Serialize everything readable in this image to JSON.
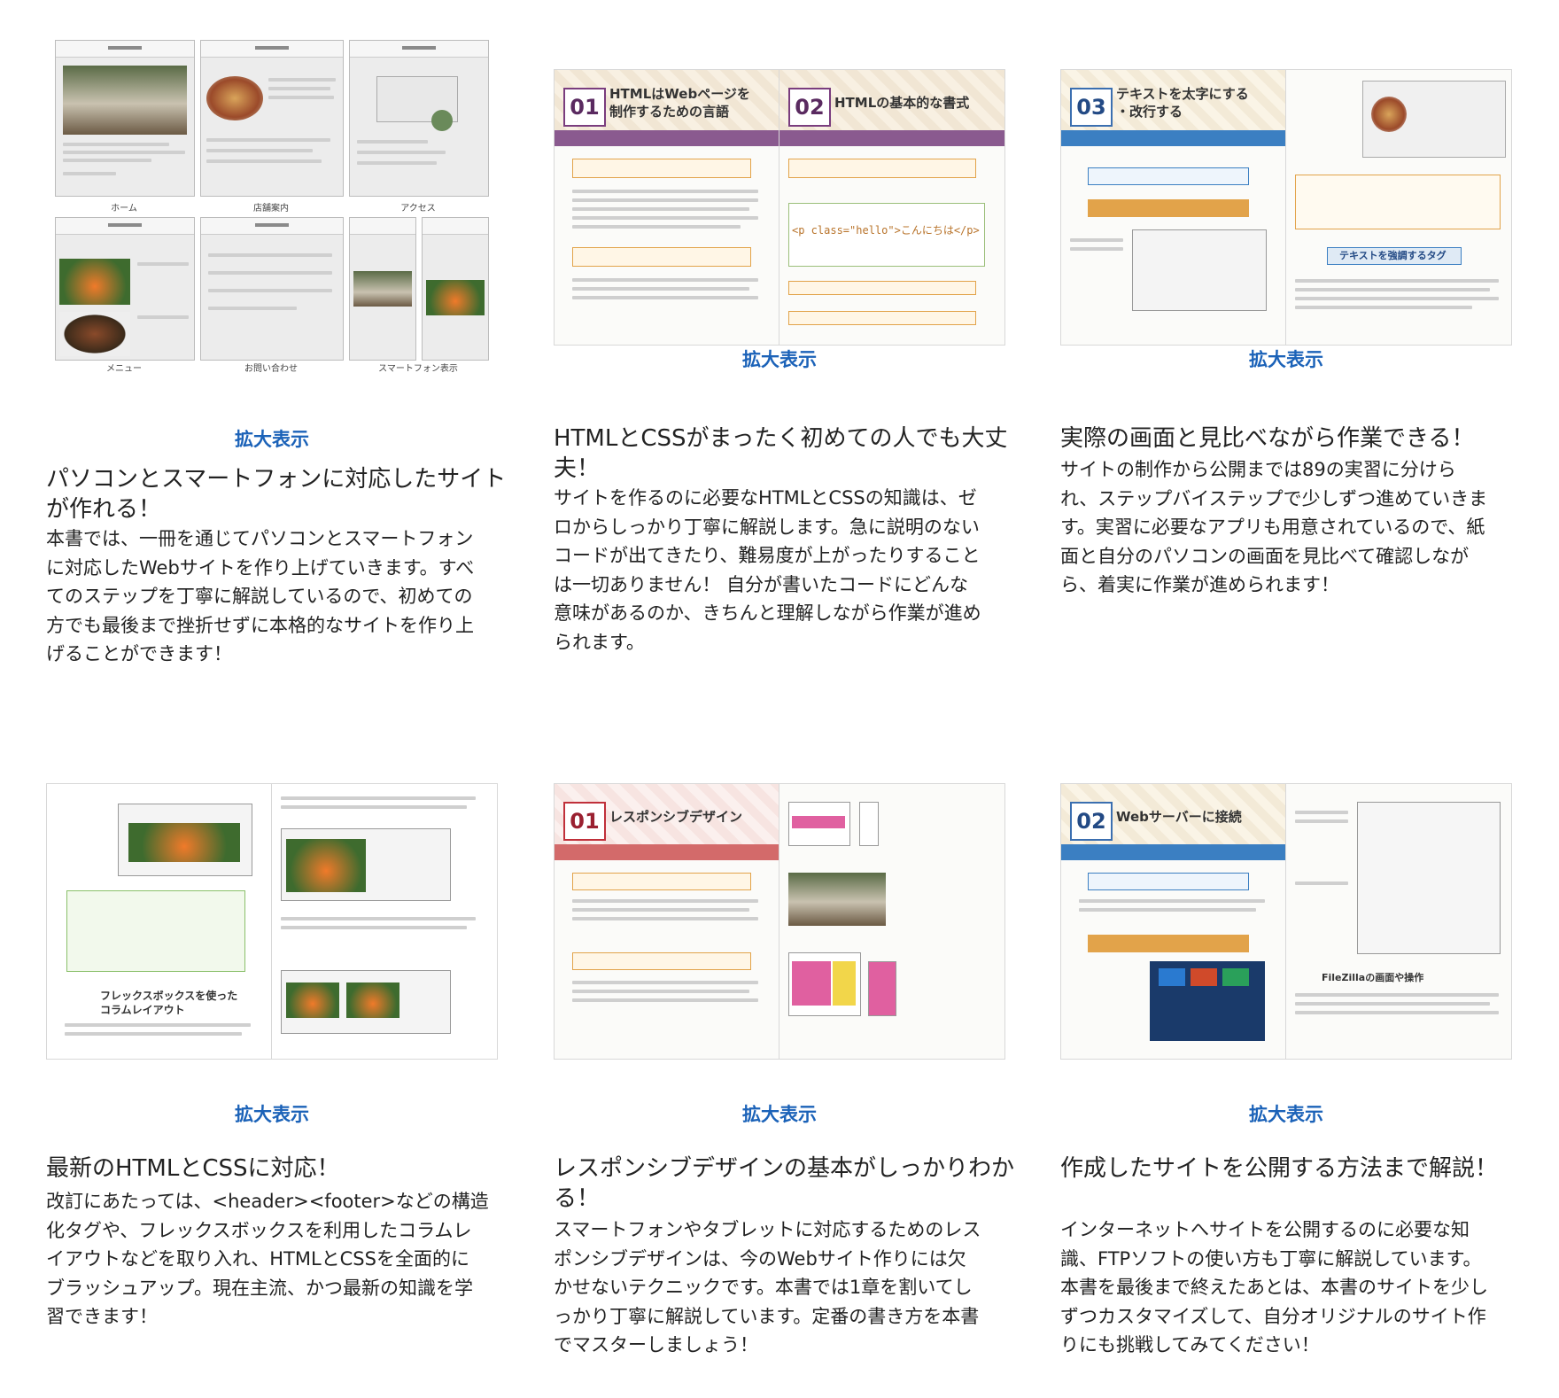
{
  "zoom_label": "拡大表示",
  "thumb1_captions": [
    "ホーム",
    "店舗案内",
    "アクセス",
    "メニュー",
    "お問い合わせ",
    "スマートフォン表示"
  ],
  "thumb2": {
    "left_num": "01",
    "left_title_line1": "HTMLはWebページを",
    "left_title_line2": "制作するための言語",
    "right_num": "02",
    "right_title": "HTMLの基本的な書式",
    "code": "<p class=\"hello\">こんにちは</p>"
  },
  "thumb3": {
    "num": "03",
    "title_line1": "テキストを太字にする",
    "title_line2": "・改行する",
    "sub": "テキストを強調するタグ"
  },
  "thumb4": {
    "sub_line1": "フレックスボックスを使った",
    "sub_line2": "コラムレイアウト"
  },
  "thumb5": {
    "num": "01",
    "title": "レスポンシブデザイン"
  },
  "thumb6": {
    "num": "02",
    "title": "Webサーバーに接続",
    "sub": "FileZillaの画面や操作"
  },
  "cards": [
    {
      "title": "パソコンとスマートフォンに対応したサイトが作れる！",
      "lines": [
        "本書では、一冊を通じてパソコンとスマートフォン",
        "に対応したWebサイトを作り上げていきます。すべ",
        "てのステップを丁寧に解説しているので、初めての",
        "方でも最後まで挫折せずに本格的なサイトを作り上",
        "げることができます！"
      ]
    },
    {
      "title": "HTMLとCSSがまったく初めての人でも大丈夫！",
      "lines": [
        "サイトを作るのに必要なHTMLとCSSの知識は、ゼ",
        "ロからしっかり丁寧に解説します。急に説明のない",
        "コードが出てきたり、難易度が上がったりすること",
        "は一切ありません！ 自分が書いたコードにどんな",
        "意味があるのか、きちんと理解しながら作業が進め",
        "られます。"
      ]
    },
    {
      "title": "実際の画面と見比べながら作業できる！",
      "lines": [
        "サイトの制作から公開までは89の実習に分けら",
        "れ、ステップバイステップで少しずつ進めていきま",
        "す。実習に必要なアプリも用意されているので、紙",
        "面と自分のパソコンの画面を見比べて確認しなが",
        "ら、着実に作業が進められます！"
      ]
    },
    {
      "title": "最新のHTMLとCSSに対応！",
      "lines": [
        "改訂にあたっては、<header><footer>などの構造",
        "化タグや、フレックスボックスを利用したコラムレ",
        "イアウトなどを取り入れ、HTMLとCSSを全面的に",
        "ブラッシュアップ。現在主流、かつ最新の知識を学",
        "習できます！"
      ]
    },
    {
      "title": "レスポンシブデザインの基本がしっかりわかる！",
      "lines": [
        "スマートフォンやタブレットに対応するためのレス",
        "ポンシブデザインは、今のWebサイト作りには欠",
        "かせないテクニックです。本書では1章を割いてし",
        "っかり丁寧に解説しています。定番の書き方を本書",
        "でマスターしましょう！"
      ]
    },
    {
      "title": "作成したサイトを公開する方法まで解説！",
      "lines": [
        "インターネットへサイトを公開するのに必要な知",
        "識、FTPソフトの使い方も丁寧に解説しています。",
        "本書を最後まで終えたあとは、本書のサイトを少し",
        "ずつカスタマイズして、自分オリジナルのサイト作",
        "りにも挑戦してみてください！"
      ]
    }
  ]
}
